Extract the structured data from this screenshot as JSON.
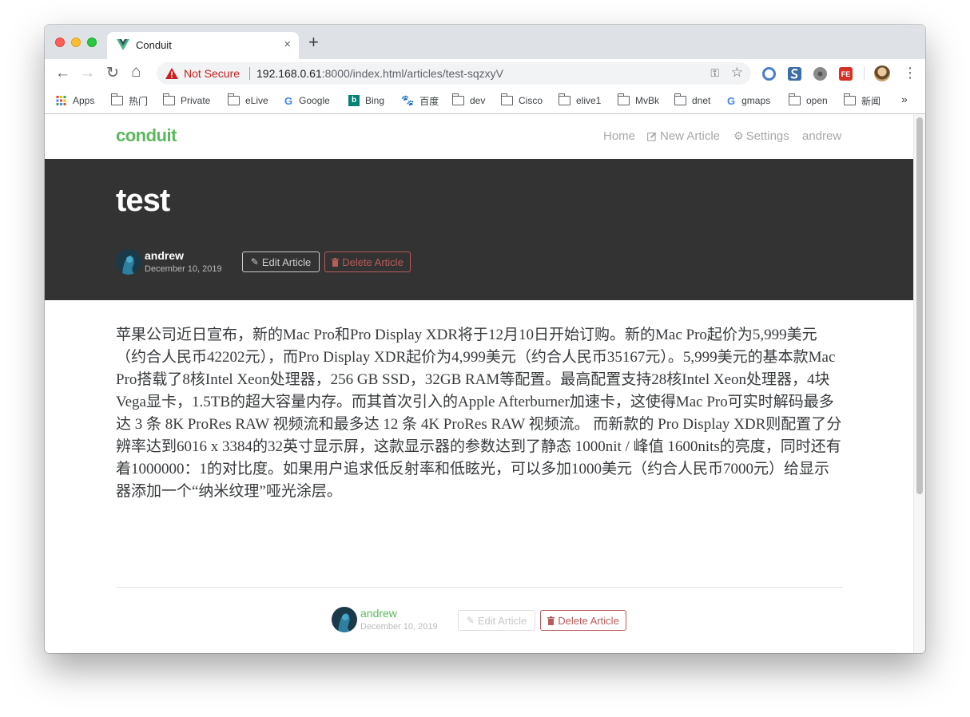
{
  "browser": {
    "tab_title": "Conduit",
    "tab_close": "×",
    "new_tab": "+",
    "security_label": "Not Secure",
    "url_host": "192.168.0.61",
    "url_rest": ":8000/index.html/articles/test-sqzxyV",
    "nav": {
      "back": "←",
      "forward": "→",
      "reload": "↻",
      "home": "⌂"
    },
    "menu": "⋮",
    "bookmarks": [
      {
        "label": "Apps",
        "icon": "apps-grid-icon"
      },
      {
        "label": "热门",
        "icon": "folder-icon"
      },
      {
        "label": "Private",
        "icon": "folder-icon"
      },
      {
        "label": "eLive",
        "icon": "folder-icon"
      },
      {
        "label": "Google",
        "icon": "google-icon"
      },
      {
        "label": "Bing",
        "icon": "bing-icon"
      },
      {
        "label": "百度",
        "icon": "baidu-icon"
      },
      {
        "label": "dev",
        "icon": "folder-icon"
      },
      {
        "label": "Cisco",
        "icon": "folder-icon"
      },
      {
        "label": "elive1",
        "icon": "folder-icon"
      },
      {
        "label": "MvBk",
        "icon": "folder-icon"
      },
      {
        "label": "dnet",
        "icon": "folder-icon"
      },
      {
        "label": "gmaps",
        "icon": "google-icon"
      },
      {
        "label": "open",
        "icon": "folder-icon"
      },
      {
        "label": "新闻",
        "icon": "folder-icon"
      }
    ],
    "bookmarks_more": "»"
  },
  "site": {
    "brand": "conduit",
    "nav": {
      "home": "Home",
      "new_article": "New Article",
      "settings": "Settings",
      "user": "andrew"
    },
    "colors": {
      "brand": "#5cb85c",
      "banner": "#333333",
      "danger": "#b85c5c"
    }
  },
  "article": {
    "title": "test",
    "author": "andrew",
    "date": "December 10, 2019",
    "edit_label": "Edit Article",
    "delete_label": "Delete Article",
    "body": "苹果公司近日宣布，新的Mac Pro和Pro Display XDR将于12月10日开始订购。新的Mac Pro起价为5,999美元（约合人民币42202元），而Pro Display XDR起价为4,999美元（约合人民币35167元）。5,999美元的基本款Mac Pro搭载了8核Intel Xeon处理器，256 GB SSD，32GB RAM等配置。最高配置支持28核Intel Xeon处理器，4块Vega显卡，1.5TB的超大容量内存。而其首次引入的Apple Afterburner加速卡，这使得Mac Pro可实时解码最多达 3 条 8K ProRes RAW 视频流和最多达 12 条 4K ProRes RAW 视频流。 而新款的 Pro Display XDR则配置了分辨率达到6016 x 3384的32英寸显示屏，这款显示器的参数达到了静态 1000nit / 峰值 1600nits的亮度，同时还有着1000000：1的对比度。如果用户追求低反射率和低眩光，可以多加1000美元（约合人民币7000元）给显示器添加一个“纳米纹理”哑光涂层。"
  }
}
